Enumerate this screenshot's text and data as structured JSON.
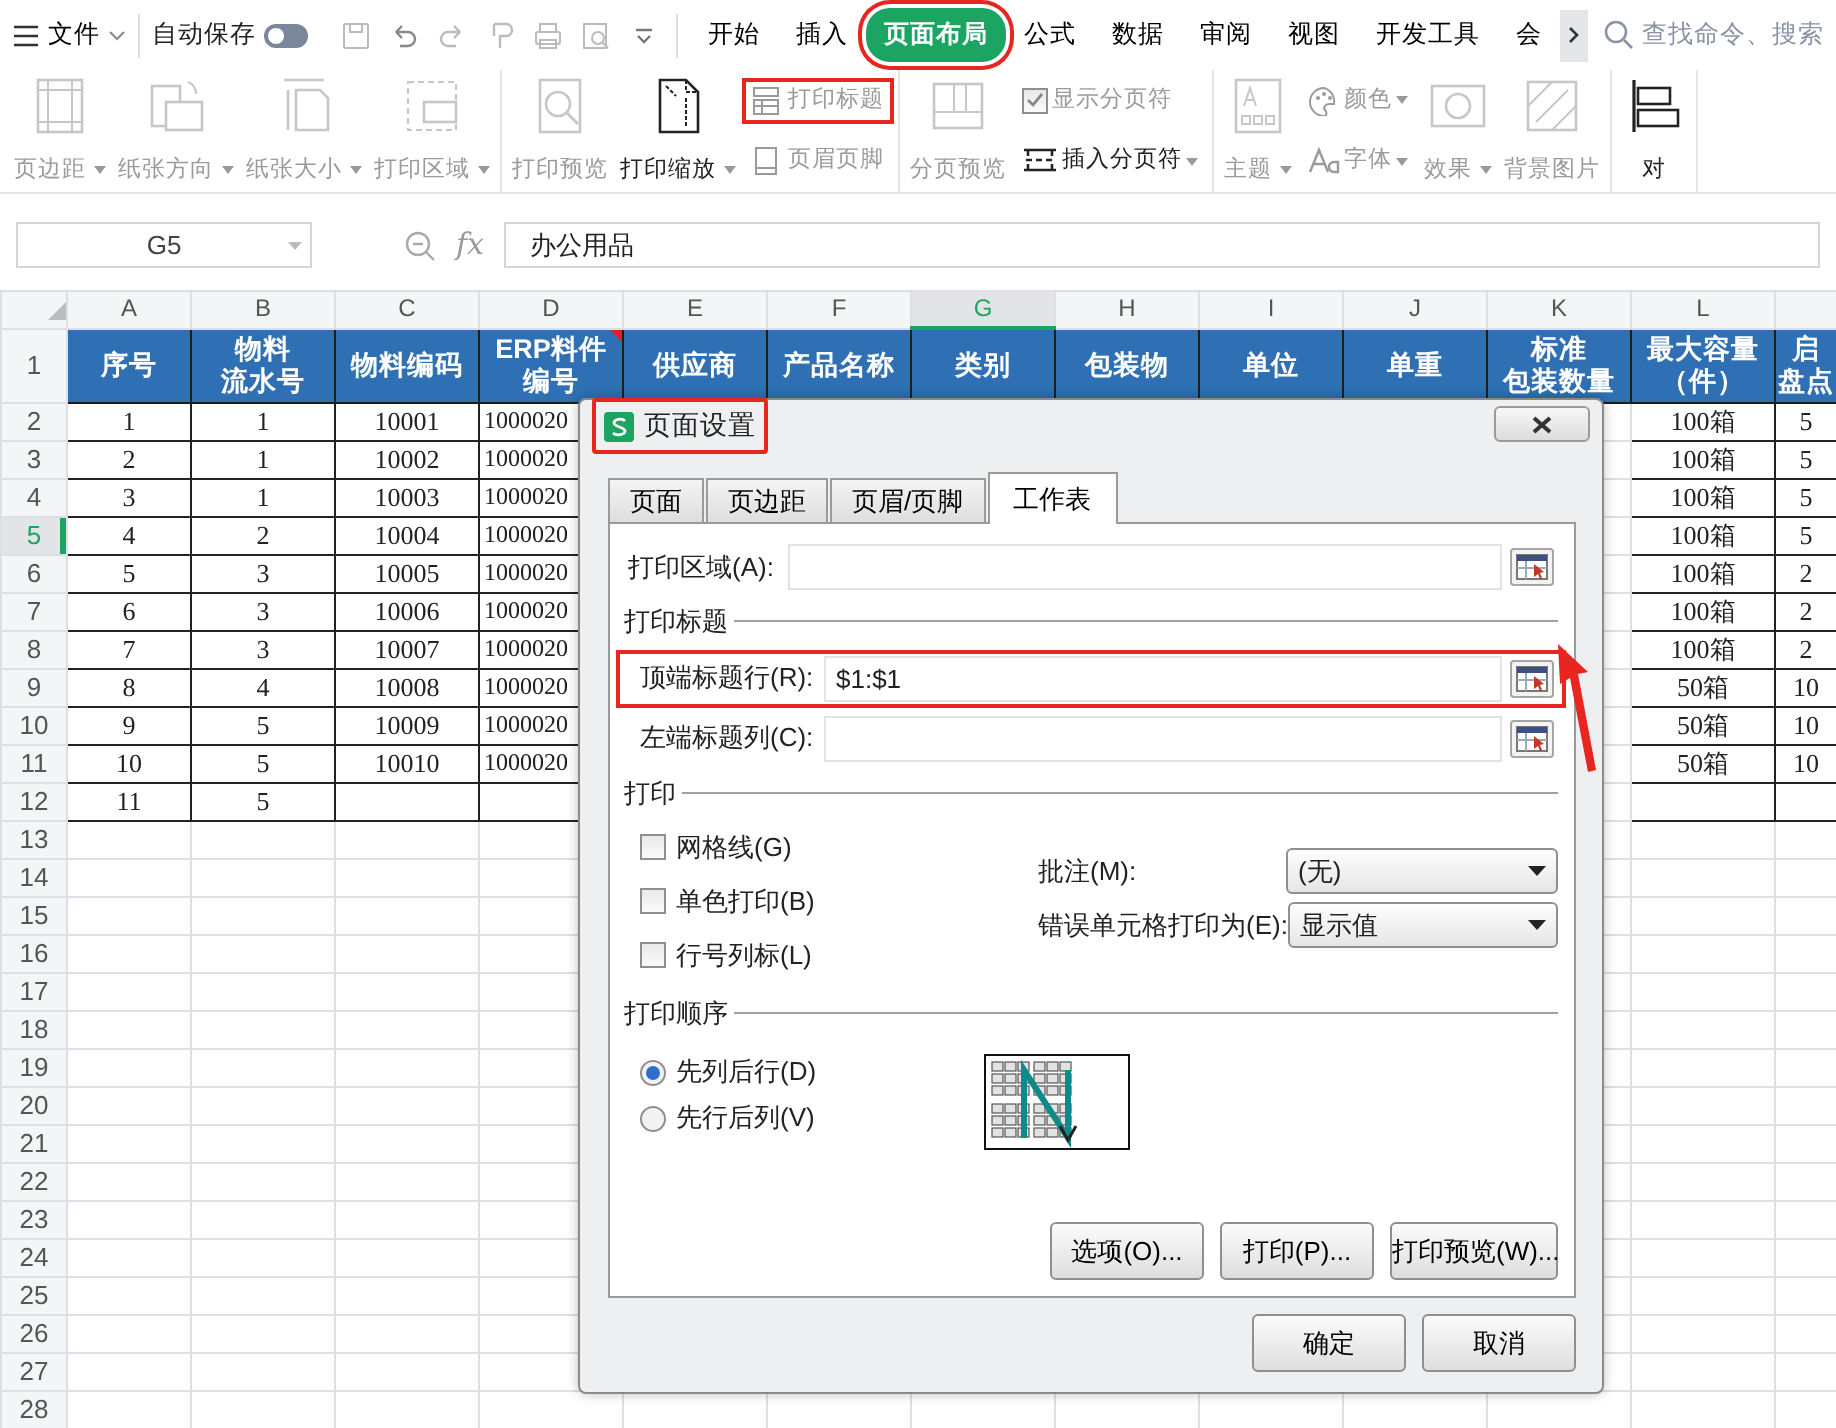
{
  "top_bar": {
    "menu_label": "文件",
    "autosave_label": "自动保存",
    "autosave_on": false,
    "tabs": [
      {
        "label": "开始",
        "selected": false,
        "highlighted": false
      },
      {
        "label": "插入",
        "selected": false,
        "highlighted": false
      },
      {
        "label": "页面布局",
        "selected": true,
        "highlighted": true
      },
      {
        "label": "公式",
        "selected": false,
        "highlighted": false
      },
      {
        "label": "数据",
        "selected": false,
        "highlighted": false
      },
      {
        "label": "审阅",
        "selected": false,
        "highlighted": false
      },
      {
        "label": "视图",
        "selected": false,
        "highlighted": false
      },
      {
        "label": "开发工具",
        "selected": false,
        "highlighted": false
      },
      {
        "label": "会",
        "selected": false,
        "highlighted": false
      }
    ],
    "search_placeholder": "查找命令、搜索"
  },
  "ribbon": {
    "groups": [
      [
        {
          "kind": "big",
          "label": "页边距",
          "caret": true,
          "disabled": true
        },
        {
          "kind": "big",
          "label": "纸张方向",
          "caret": true,
          "disabled": true
        },
        {
          "kind": "big",
          "label": "纸张大小",
          "caret": true,
          "disabled": true
        },
        {
          "kind": "big",
          "label": "打印区域",
          "caret": true,
          "disabled": true
        }
      ],
      [
        {
          "kind": "big",
          "label": "打印预览",
          "caret": false,
          "disabled": true
        },
        {
          "kind": "big",
          "label": "打印缩放",
          "caret": true,
          "disabled": false
        },
        {
          "kind": "stack",
          "items": [
            {
              "kind": "small",
              "label": "打印标题",
              "caret": false,
              "disabled": true,
              "highlighted": true
            },
            {
              "kind": "small",
              "label": "页眉页脚",
              "caret": false,
              "disabled": true,
              "highlighted": false
            }
          ]
        }
      ],
      [
        {
          "kind": "big",
          "label": "分页预览",
          "caret": false,
          "disabled": true
        },
        {
          "kind": "stack",
          "items": [
            {
              "kind": "check",
              "label": "显示分页符",
              "checked": true,
              "disabled": true
            },
            {
              "kind": "small",
              "label": "插入分页符",
              "caret": true,
              "disabled": false,
              "highlighted": false
            }
          ]
        }
      ],
      [
        {
          "kind": "big",
          "label": "主题",
          "caret": true,
          "disabled": true
        },
        {
          "kind": "stack",
          "items": [
            {
              "kind": "small",
              "label": "颜色",
              "caret": true,
              "disabled": true,
              "highlighted": false
            },
            {
              "kind": "small",
              "label": "字体",
              "caret": true,
              "disabled": true,
              "highlighted": false
            }
          ]
        },
        {
          "kind": "big",
          "label": "效果",
          "caret": true,
          "disabled": true
        },
        {
          "kind": "big",
          "label": "背景图片",
          "caret": false,
          "disabled": true
        }
      ],
      [
        {
          "kind": "big",
          "label": "对",
          "caret": false,
          "disabled": false
        }
      ]
    ]
  },
  "formula_bar": {
    "name_box": "G5",
    "function_label": "fx",
    "formula": "办公用品"
  },
  "sheet": {
    "columns": [
      {
        "label": "A",
        "selected": false
      },
      {
        "label": "B",
        "selected": false
      },
      {
        "label": "C",
        "selected": false
      },
      {
        "label": "D",
        "selected": false
      },
      {
        "label": "E",
        "selected": false
      },
      {
        "label": "F",
        "selected": false
      },
      {
        "label": "G",
        "selected": true
      },
      {
        "label": "H",
        "selected": false
      },
      {
        "label": "I",
        "selected": false
      },
      {
        "label": "J",
        "selected": false
      },
      {
        "label": "K",
        "selected": false
      },
      {
        "label": "L",
        "selected": false
      }
    ],
    "header_row": {
      "number": "1",
      "cells": [
        {
          "lines": [
            "序号"
          ],
          "comment": false
        },
        {
          "lines": [
            "物料",
            "流水号"
          ],
          "comment": false
        },
        {
          "lines": [
            "物料编码"
          ],
          "comment": false
        },
        {
          "lines": [
            "ERP料件",
            "编号"
          ],
          "comment": true
        },
        {
          "lines": [
            "供应商"
          ],
          "comment": false
        },
        {
          "lines": [
            "产品名称"
          ],
          "comment": false
        },
        {
          "lines": [
            "类别"
          ],
          "comment": false
        },
        {
          "lines": [
            "包装物"
          ],
          "comment": false
        },
        {
          "lines": [
            "单位"
          ],
          "comment": false
        },
        {
          "lines": [
            "单重"
          ],
          "comment": false
        },
        {
          "lines": [
            "标准",
            "包装数量"
          ],
          "comment": false
        },
        {
          "lines": [
            "最大容量",
            "（件）"
          ],
          "comment": false
        },
        {
          "lines": [
            "启",
            "盘点"
          ],
          "comment": false
        }
      ]
    },
    "rows": [
      {
        "number": "2",
        "selected": false,
        "a": "1",
        "b": "1",
        "c": "10001",
        "d": "1000020",
        "l": "100箱",
        "m": "5"
      },
      {
        "number": "3",
        "selected": false,
        "a": "2",
        "b": "1",
        "c": "10002",
        "d": "1000020",
        "l": "100箱",
        "m": "5"
      },
      {
        "number": "4",
        "selected": false,
        "a": "3",
        "b": "1",
        "c": "10003",
        "d": "1000020",
        "l": "100箱",
        "m": "5"
      },
      {
        "number": "5",
        "selected": true,
        "a": "4",
        "b": "2",
        "c": "10004",
        "d": "1000020",
        "l": "100箱",
        "m": "5"
      },
      {
        "number": "6",
        "selected": false,
        "a": "5",
        "b": "3",
        "c": "10005",
        "d": "1000020",
        "l": "100箱",
        "m": "2"
      },
      {
        "number": "7",
        "selected": false,
        "a": "6",
        "b": "3",
        "c": "10006",
        "d": "1000020",
        "l": "100箱",
        "m": "2"
      },
      {
        "number": "8",
        "selected": false,
        "a": "7",
        "b": "3",
        "c": "10007",
        "d": "1000020",
        "l": "100箱",
        "m": "2"
      },
      {
        "number": "9",
        "selected": false,
        "a": "8",
        "b": "4",
        "c": "10008",
        "d": "1000020",
        "l": "50箱",
        "m": "10"
      },
      {
        "number": "10",
        "selected": false,
        "a": "9",
        "b": "5",
        "c": "10009",
        "d": "1000020",
        "l": "50箱",
        "m": "10"
      },
      {
        "number": "11",
        "selected": false,
        "a": "10",
        "b": "5",
        "c": "10010",
        "d": "1000020",
        "l": "50箱",
        "m": "10"
      },
      {
        "number": "12",
        "selected": false,
        "a": "11",
        "b": "5"
      },
      {
        "number": "13",
        "selected": false
      },
      {
        "number": "14",
        "selected": false
      },
      {
        "number": "15",
        "selected": false
      },
      {
        "number": "16",
        "selected": false
      },
      {
        "number": "17",
        "selected": false
      },
      {
        "number": "18",
        "selected": false
      },
      {
        "number": "19",
        "selected": false
      },
      {
        "number": "20",
        "selected": false
      },
      {
        "number": "21",
        "selected": false
      },
      {
        "number": "22",
        "selected": false
      },
      {
        "number": "23",
        "selected": false
      },
      {
        "number": "24",
        "selected": false
      },
      {
        "number": "25",
        "selected": false
      },
      {
        "number": "26",
        "selected": false
      },
      {
        "number": "27",
        "selected": false
      },
      {
        "number": "28",
        "selected": false
      }
    ]
  },
  "dialog": {
    "title": "页面设置",
    "title_highlighted": true,
    "tabs": [
      {
        "label": "页面",
        "selected": false
      },
      {
        "label": "页边距",
        "selected": false
      },
      {
        "label": "页眉/页脚",
        "selected": false
      },
      {
        "label": "工作表",
        "selected": true
      }
    ],
    "print_area": {
      "label": "打印区域(A):"
    },
    "titles_section": "打印标题",
    "title_fields": [
      {
        "label": "顶端标题行(R):",
        "value": "$1:$1",
        "highlighted": true
      },
      {
        "label": "左端标题列(C):",
        "highlighted": false
      }
    ],
    "print_section": "打印",
    "checkboxes": [
      {
        "label": "网格线(G)",
        "checked": false
      },
      {
        "label": "单色打印(B)",
        "checked": false
      },
      {
        "label": "行号列标(L)",
        "checked": false
      }
    ],
    "selects": [
      {
        "label": "批注(M):",
        "value": "(无)"
      },
      {
        "label": "错误单元格打印为(E):",
        "value": "显示值"
      }
    ],
    "order_section": "打印顺序",
    "radios": [
      {
        "label": "先列后行(D)",
        "selected": true
      },
      {
        "label": "先行后列(V)",
        "selected": false
      }
    ],
    "panel_buttons": [
      "选项(O)...",
      "打印(P)...",
      "打印预览(W)..."
    ],
    "buttons": [
      "确定",
      "取消"
    ]
  }
}
